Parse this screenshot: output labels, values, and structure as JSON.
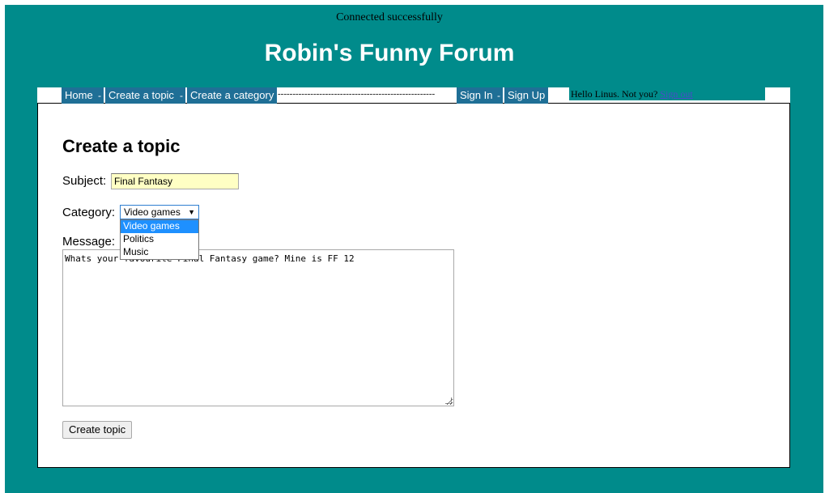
{
  "status": {
    "connection": "Connected successfully"
  },
  "forum": {
    "title": "Robin's Funny Forum"
  },
  "nav": {
    "home": "Home",
    "create_topic": "Create a topic",
    "create_category": "Create a category",
    "separator": "-",
    "dashes": "-----------------------------------------------------",
    "sign_in": "Sign In",
    "sign_up": "Sign Up"
  },
  "user": {
    "greeting": "Hello Linus. Not you?",
    "sign_out": "Sign out"
  },
  "form": {
    "heading": "Create a topic",
    "subject_label": "Subject:",
    "subject_value": "Final Fantasy",
    "category_label": "Category:",
    "category_selected": "Video games",
    "category_options": [
      "Video games",
      "Politics",
      "Music"
    ],
    "message_label": "Message:",
    "message_value": "Whats your favourite Final Fantasy game? Mine is FF 12",
    "submit_label": "Create topic"
  },
  "colors": {
    "background": "#008b8b",
    "nav_item": "#1f6f96",
    "subject_field": "#ffffc4",
    "option_highlight": "#1e90ff"
  }
}
